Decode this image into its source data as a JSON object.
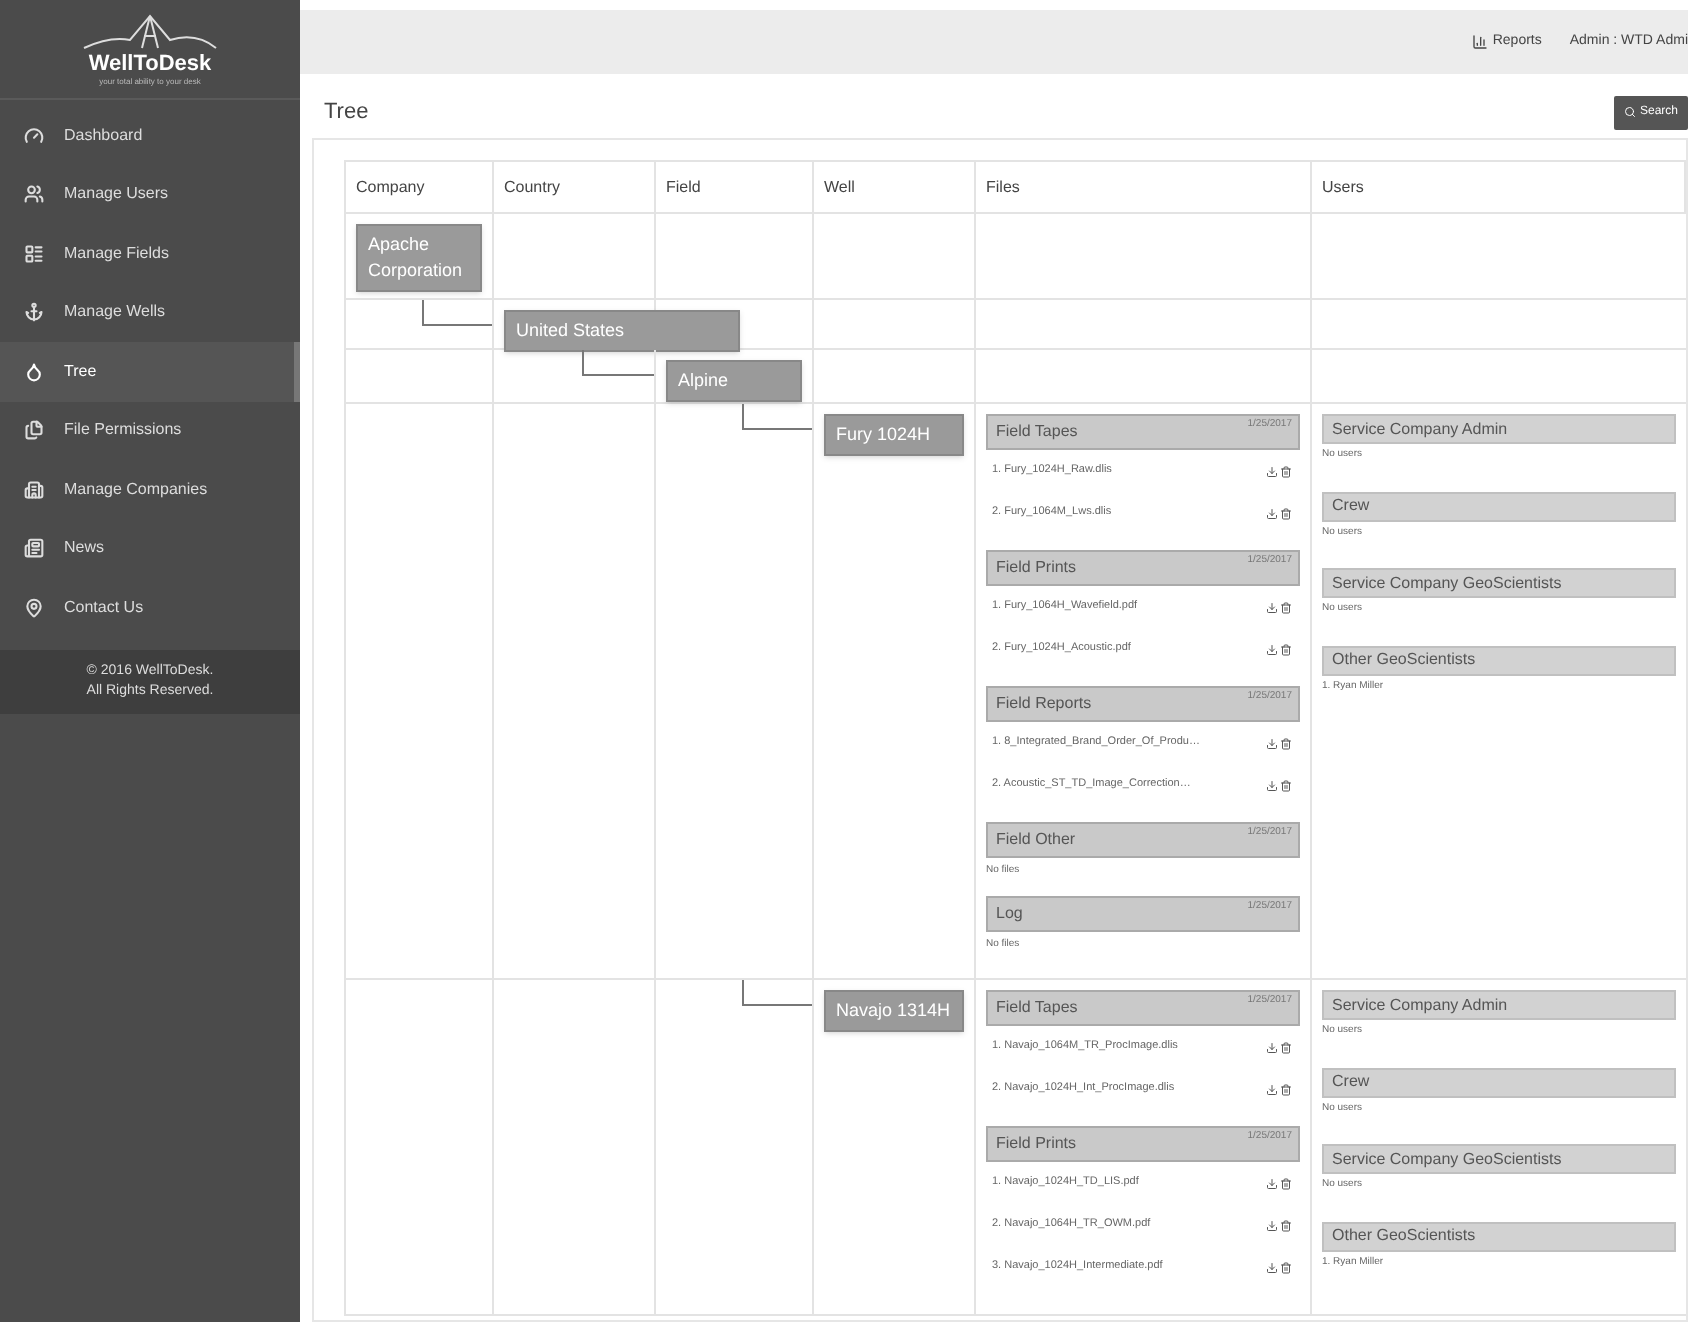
{
  "sidebar": {
    "logo": "WellToDesk",
    "tagline": "your total ability to your desk",
    "items": [
      {
        "label": "Dashboard",
        "selected": false
      },
      {
        "label": "Manage Users",
        "selected": false
      },
      {
        "label": "Manage Fields",
        "selected": false
      },
      {
        "label": "Manage Wells",
        "selected": false
      },
      {
        "label": "Tree",
        "selected": true
      },
      {
        "label": "File Permissions",
        "selected": false
      },
      {
        "label": "Manage Companies",
        "selected": false
      },
      {
        "label": "News",
        "selected": false
      },
      {
        "label": "Contact Us",
        "selected": false
      }
    ],
    "footer": [
      "© 2016 WellToDesk.",
      "All Rights Reserved."
    ]
  },
  "top_bar": {
    "reports": "Reports",
    "user": "Admin : WTD Admi"
  },
  "page": {
    "title": "Tree",
    "search_button": "Search"
  },
  "tree": {
    "columns": [
      "Company",
      "Country",
      "Field",
      "Well",
      "Files",
      "Users"
    ],
    "root": {
      "name": "Apache Corporation",
      "children": [
        {
          "name": "United States",
          "children": [
            {
              "name": "Alpine",
              "children": [
                {
                  "name": "Fury 1024H",
                  "file_groups": [
                    {
                      "title": "Field Tapes",
                      "date": "1/25/2017",
                      "files": [
                        "1. Fury_1024H_Raw.dlis",
                        "2. Fury_1064M_Lws.dlis"
                      ]
                    },
                    {
                      "title": "Field Prints",
                      "date": "1/25/2017",
                      "files": [
                        "1. Fury_1064H_Wavefield.pdf",
                        "2. Fury_1024H_Acoustic.pdf"
                      ]
                    },
                    {
                      "title": "Field Reports",
                      "date": "1/25/2017",
                      "files": [
                        "1. 8_Integrated_Brand_Order_Of_Produ…",
                        "2. Acoustic_ST_TD_Image_Correction…"
                      ]
                    },
                    {
                      "title": "Field Other",
                      "date": "1/25/2017",
                      "empty": "No files"
                    },
                    {
                      "title": "Log",
                      "date": "1/25/2017",
                      "empty": "No files"
                    }
                  ],
                  "user_groups": [
                    {
                      "title": "Service Company Admin",
                      "empty": "No users"
                    },
                    {
                      "title": "Crew",
                      "empty": "No users"
                    },
                    {
                      "title": "Service Company GeoScientists",
                      "empty": "No users"
                    },
                    {
                      "title": "Other GeoScientists",
                      "users": [
                        "1. Ryan Miller"
                      ]
                    }
                  ]
                },
                {
                  "name": "Navajo 1314H",
                  "file_groups": [
                    {
                      "title": "Field Tapes",
                      "date": "1/25/2017",
                      "files": [
                        "1. Navajo_1064M_TR_ProcImage.dlis",
                        "2. Navajo_1024H_Int_ProcImage.dlis"
                      ]
                    },
                    {
                      "title": "Field Prints",
                      "date": "1/25/2017",
                      "files": [
                        "1. Navajo_1024H_TD_LIS.pdf",
                        "2. Navajo_1064H_TR_OWM.pdf",
                        "3. Navajo_1024H_Intermediate.pdf"
                      ]
                    }
                  ],
                  "user_groups": [
                    {
                      "title": "Service Company Admin",
                      "empty": "No users"
                    },
                    {
                      "title": "Crew",
                      "empty": "No users"
                    },
                    {
                      "title": "Service Company GeoScientists",
                      "empty": "No users"
                    },
                    {
                      "title": "Other GeoScientists",
                      "users": [
                        "1. Ryan Miller"
                      ]
                    }
                  ]
                }
              ]
            }
          ]
        }
      ]
    }
  }
}
